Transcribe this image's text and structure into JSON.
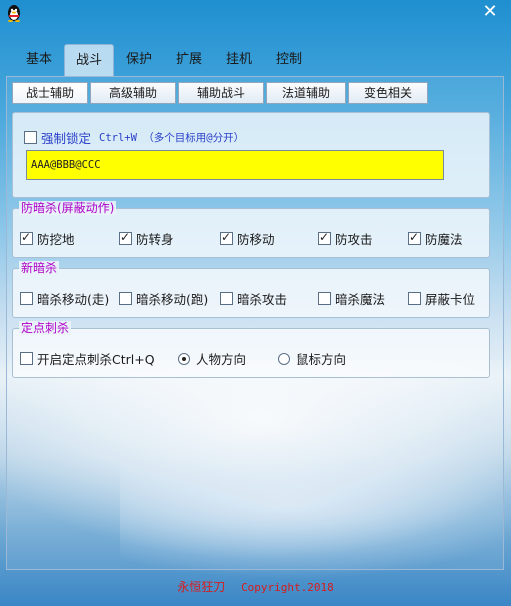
{
  "titlebar": {
    "close_label": "✕",
    "icon": "qq-penguin-icon"
  },
  "main_tabs": [
    "基本",
    "战斗",
    "保护",
    "扩展",
    "挂机",
    "控制"
  ],
  "sub_tabs": [
    "战士辅助",
    "高级辅助",
    "辅助战斗",
    "法道辅助",
    "变色相关"
  ],
  "lock": {
    "label": "强制锁定",
    "hint": "Ctrl+W （多个目标用@分开）",
    "checked": false,
    "input_value": "AAA@BBB@CCC"
  },
  "anti_assassin": {
    "title": "防暗杀(屏蔽动作)",
    "items": [
      {
        "label": "防挖地",
        "checked": true
      },
      {
        "label": "防转身",
        "checked": true
      },
      {
        "label": "防移动",
        "checked": true
      },
      {
        "label": "防攻击",
        "checked": true
      },
      {
        "label": "防魔法",
        "checked": true
      }
    ]
  },
  "new_assassin": {
    "title": "新暗杀",
    "items": [
      {
        "label": "暗杀移动(走)",
        "checked": false
      },
      {
        "label": "暗杀移动(跑)",
        "checked": false
      },
      {
        "label": "暗杀攻击",
        "checked": false
      },
      {
        "label": "暗杀魔法",
        "checked": false
      },
      {
        "label": "屏蔽卡位",
        "checked": false
      }
    ]
  },
  "fixed_stab": {
    "title": "定点刺杀",
    "enable_label": "开启定点刺杀Ctrl+Q",
    "enable_checked": false,
    "options": [
      {
        "label": "人物方向",
        "selected": true
      },
      {
        "label": "鼠标方向",
        "selected": false
      }
    ]
  },
  "footer": {
    "name": "永恒狂刀",
    "copyright": "Copyright.2018"
  },
  "colors": {
    "group_title": "#b000c8",
    "lock_label": "#2b3fc8",
    "input_bg": "#ffff00",
    "footer_text": "#d81b1b"
  }
}
